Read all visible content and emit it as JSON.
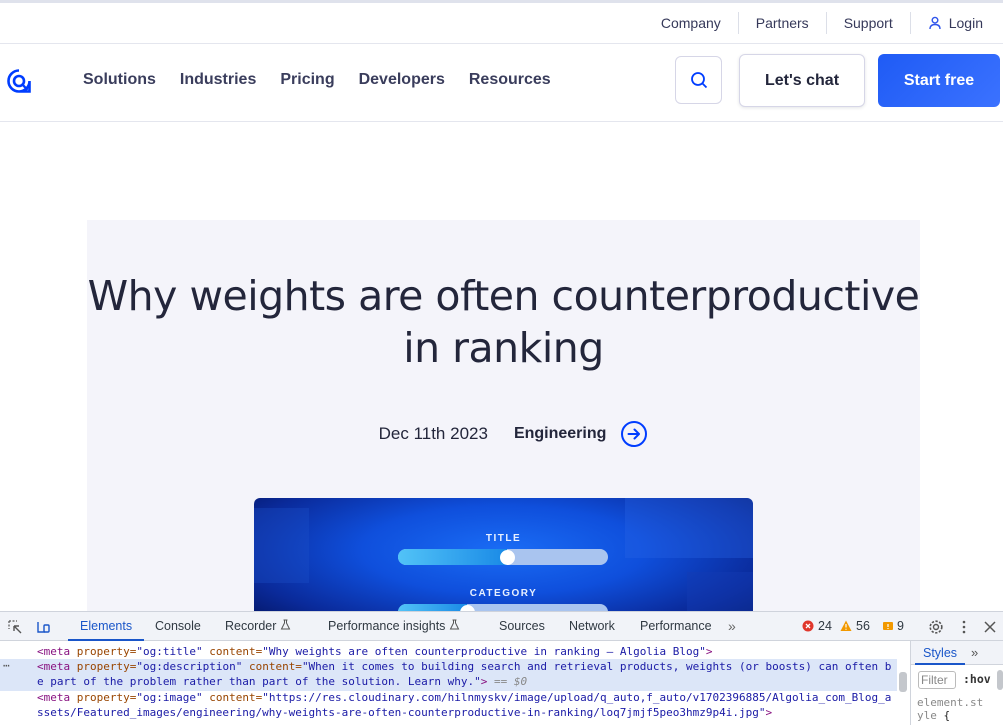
{
  "topbar": {
    "links": [
      "Company",
      "Partners",
      "Support"
    ],
    "login": "Login"
  },
  "nav": {
    "items": [
      "Solutions",
      "Industries",
      "Pricing",
      "Developers",
      "Resources"
    ],
    "chat_label": "Let's chat",
    "start_label": "Start free"
  },
  "article": {
    "title": "Why weights are often counterproductive in ranking",
    "date": "Dec 11th 2023",
    "category": "Engineering"
  },
  "feature_image": {
    "sliders": [
      {
        "label": "TITLE",
        "value": 0.52
      },
      {
        "label": "CATEGORY",
        "value": 0.33
      }
    ]
  },
  "devtools": {
    "tabs": [
      "Elements",
      "Console",
      "Recorder",
      "Performance insights",
      "Sources",
      "Network",
      "Performance"
    ],
    "active_tab": "Elements",
    "errors": "24",
    "warnings": "56",
    "issues": "9",
    "code_lines": {
      "l1_tag": "<meta",
      "l1_attr": "property=",
      "l1_val": "\"og:title\"",
      "l1_attr2": "content=",
      "l1_val2": "\"Why weights are often counterproductive in ranking – Algolia Blog\"",
      "l1_end": ">",
      "l2_tag": "<meta",
      "l2_attr": "property=",
      "l2_val": "\"og:description\"",
      "l2_attr2": "content=",
      "l2_val2": "\"When it comes to building search and retrieval products, weights (or boosts) can often b",
      "l3_val": "e part of the problem rather than part of the solution. Learn why.\"",
      "l3_end": ">",
      "l3_dollar": "== $0",
      "l4_tag": "<meta",
      "l4_attr": "property=",
      "l4_val": "\"og:image\"",
      "l4_attr2": "content=",
      "l4_val2": "\"https://res.cloudinary.com/hilnmyskv/image/upload/q_auto,f_auto/v1702396885/Algolia_com_Blog_a",
      "l5_val": "ssets/Featured_images/engineering/why-weights-are-often-counterproductive-in-ranking/loq7jmjf5peo3hmz9p4i.jpg\"",
      "l5_end": ">"
    },
    "styles_tab": "Styles",
    "filter_placeholder": "Filter",
    "hov": ":hov",
    "element_style": "element.style",
    "brace": "{"
  }
}
